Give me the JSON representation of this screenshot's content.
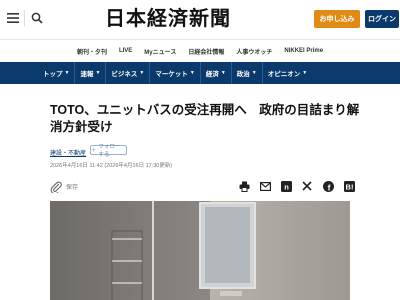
{
  "header": {
    "logo": "日本経済新聞",
    "signup_label": "お申し込み",
    "login_label": "ログイン"
  },
  "sublinks": [
    "朝刊・夕刊",
    "LIVE",
    "Myニュース",
    "日経会社情報",
    "人事ウオッチ",
    "NIKKEI Prime"
  ],
  "nav": [
    "トップ",
    "速報",
    "ビジネス",
    "マーケット",
    "経済",
    "政治",
    "オピニオン"
  ],
  "article": {
    "headline": "TOTO、ユニットバスの受注再開へ　政府の目詰まり解消方針受け",
    "category": "建設・不動産",
    "follow_label": "フォローする",
    "dateline": "2026年4月16日 11:42 (2026年4月16日 17:30更新)",
    "save_label": "保存"
  },
  "colors": {
    "brand_navy": "#0a3a6b",
    "signup_orange": "#e08b15"
  }
}
